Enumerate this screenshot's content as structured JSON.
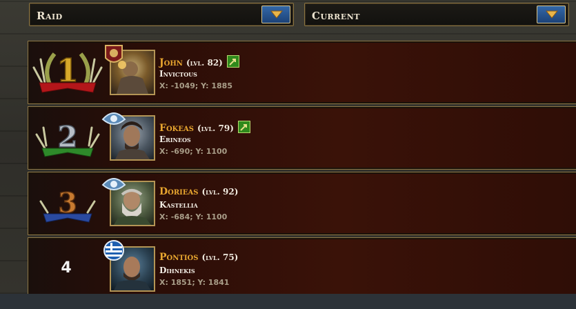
{
  "filters": {
    "type_label": "Raid",
    "period_label": "Current"
  },
  "leaderboard": [
    {
      "rank": "1",
      "name": "John",
      "level": "(lvl. 82)",
      "guild": "Invictous",
      "coords": "X: -1049; Y: 1885",
      "promoted": true
    },
    {
      "rank": "2",
      "name": "Fokeas",
      "level": "(lvl. 79)",
      "guild": "Erineos",
      "coords": "X: -690; Y: 1100",
      "promoted": true
    },
    {
      "rank": "3",
      "name": "Dorieas",
      "level": "(lvl. 92)",
      "guild": "Kastellia",
      "coords": "X: -684; Y: 1100",
      "promoted": false
    },
    {
      "rank": "4",
      "name": "Pontios",
      "level": "(lvl. 75)",
      "guild": "Dihnekis",
      "coords": "X: 1851; Y: 1841",
      "promoted": false
    }
  ],
  "colors": {
    "gold": "#e8a62f",
    "rank1": "#d8a92a",
    "rank2": "#b8bec6",
    "rank3": "#c77a30",
    "dropdown_button": "#2a5592"
  }
}
